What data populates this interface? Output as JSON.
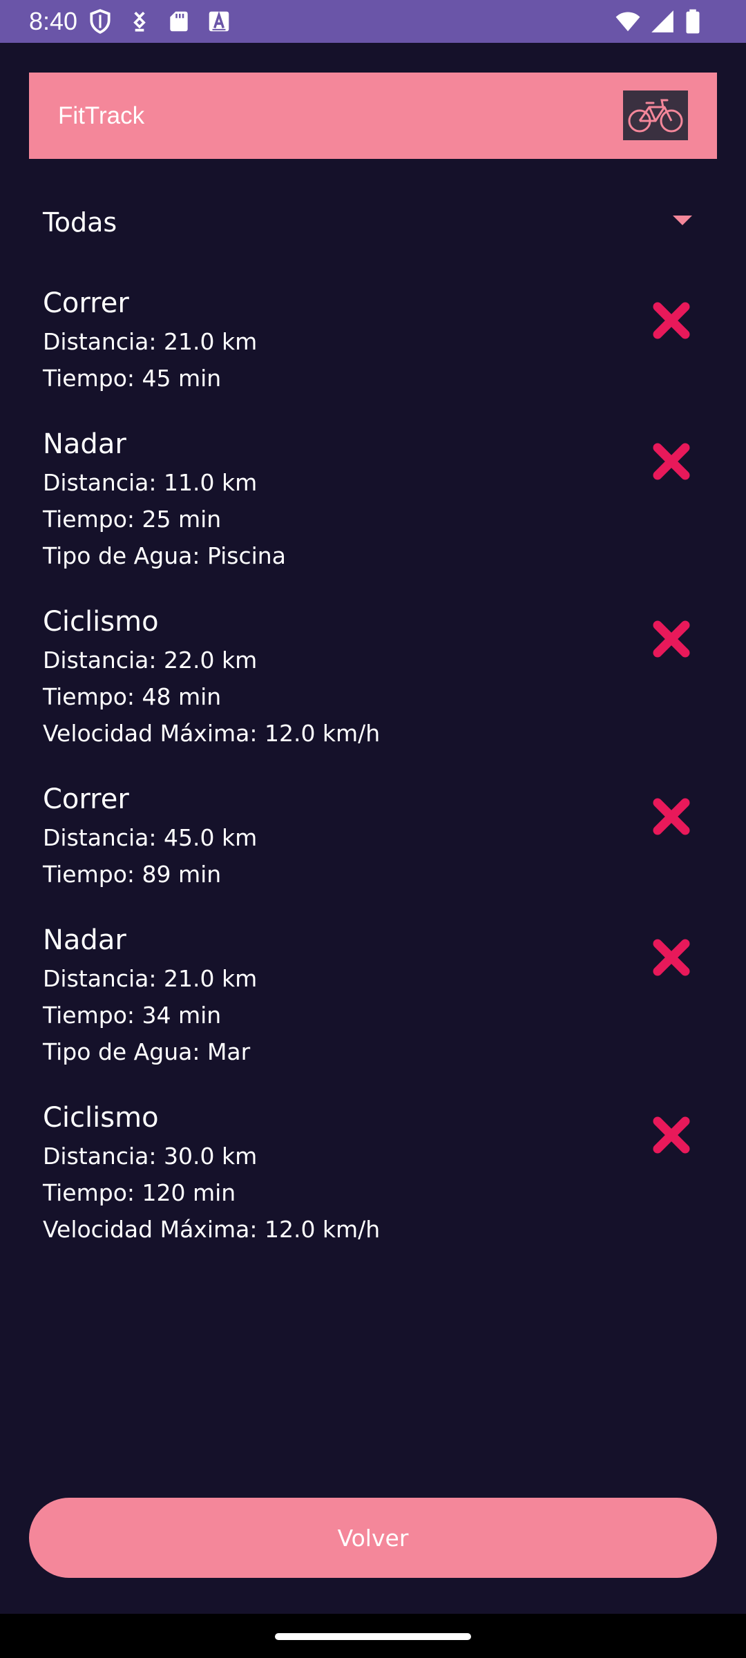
{
  "status_bar": {
    "time": "8:40",
    "icons": [
      "shield-icon",
      "data-saver-icon",
      "sd-card-icon",
      "font-a-icon",
      "wifi-icon",
      "signal-icon",
      "battery-icon"
    ]
  },
  "app_bar": {
    "title": "FitTrack",
    "logo_icon": "bicycle-icon"
  },
  "filter": {
    "selected": "Todas"
  },
  "activities": [
    {
      "type": "Correr",
      "lines": [
        "Distancia: 21.0 km",
        "Tiempo: 45 min"
      ]
    },
    {
      "type": "Nadar",
      "lines": [
        "Distancia: 11.0 km",
        "Tiempo: 25 min",
        "Tipo de Agua: Piscina"
      ]
    },
    {
      "type": "Ciclismo",
      "lines": [
        "Distancia: 22.0 km",
        "Tiempo: 48 min",
        "Velocidad Máxima: 12.0 km/h"
      ]
    },
    {
      "type": "Correr",
      "lines": [
        "Distancia: 45.0 km",
        "Tiempo: 89 min"
      ]
    },
    {
      "type": "Nadar",
      "lines": [
        "Distancia: 21.0 km",
        "Tiempo: 34 min",
        "Tipo de Agua: Mar"
      ]
    },
    {
      "type": "Ciclismo",
      "lines": [
        "Distancia: 30.0 km",
        "Tiempo: 120 min",
        "Velocidad Máxima: 12.0 km/h"
      ]
    }
  ],
  "back_button": {
    "label": "Volver"
  },
  "colors": {
    "status_bar": "#6a55a8",
    "background": "#15112a",
    "accent": "#f4879a",
    "delete": "#e8195a"
  }
}
